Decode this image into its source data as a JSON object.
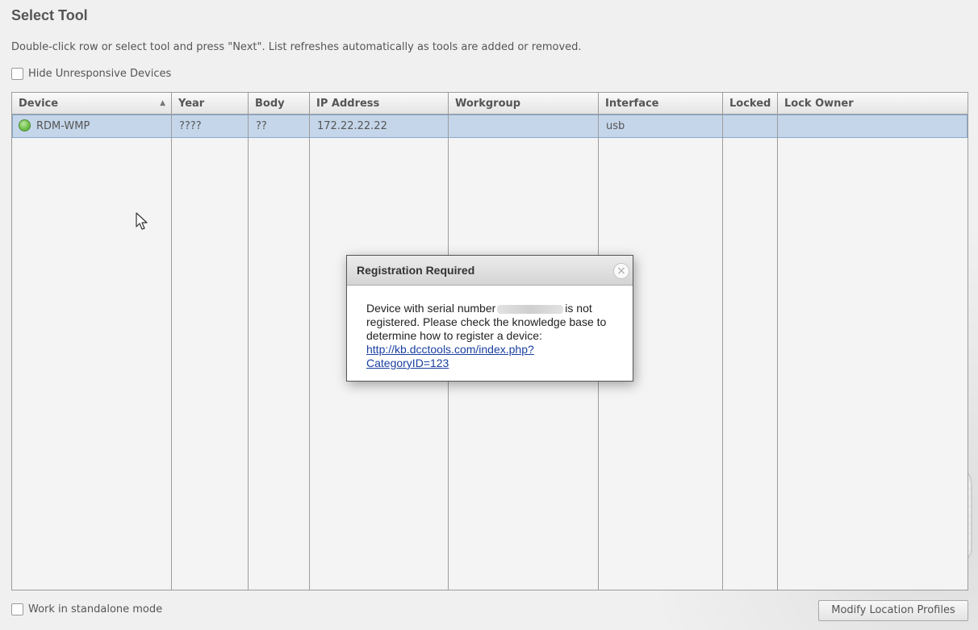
{
  "page": {
    "title": "Select Tool",
    "instructions": "Double-click row or select tool and press \"Next\".  List refreshes automatically as tools are added or removed."
  },
  "options": {
    "hide_unresponsive_label": "Hide Unresponsive Devices",
    "hide_unresponsive_checked": false,
    "standalone_label": "Work in standalone mode",
    "standalone_checked": false
  },
  "table": {
    "columns": [
      "Device",
      "Year",
      "Body",
      "IP Address",
      "Workgroup",
      "Interface",
      "Locked",
      "Lock Owner"
    ],
    "sort_column": "Device",
    "sort_direction": "ascending",
    "sort_indicator": "▲",
    "rows": [
      {
        "status": "online",
        "status_color": "#6cbf45",
        "device": "RDM-WMP",
        "year": "????",
        "body": "??",
        "ip_address": "172.22.22.22",
        "workgroup": "",
        "interface": "usb",
        "locked": "",
        "lock_owner": "",
        "selected": true
      }
    ]
  },
  "dialog": {
    "title": "Registration Required",
    "close_glyph": "×",
    "message_before_serial": "Device with serial number",
    "message_after_serial": "is not registered. Please check the knowledge base to determine how to register a device:",
    "link_line1": "http://kb.dcctools.com/index.php?",
    "link_line2": "CategoryID=123"
  },
  "footer": {
    "modify_button": "Modify Location Profiles"
  },
  "colors": {
    "selection": "#c5d6ea",
    "link": "#1a3fa0"
  }
}
